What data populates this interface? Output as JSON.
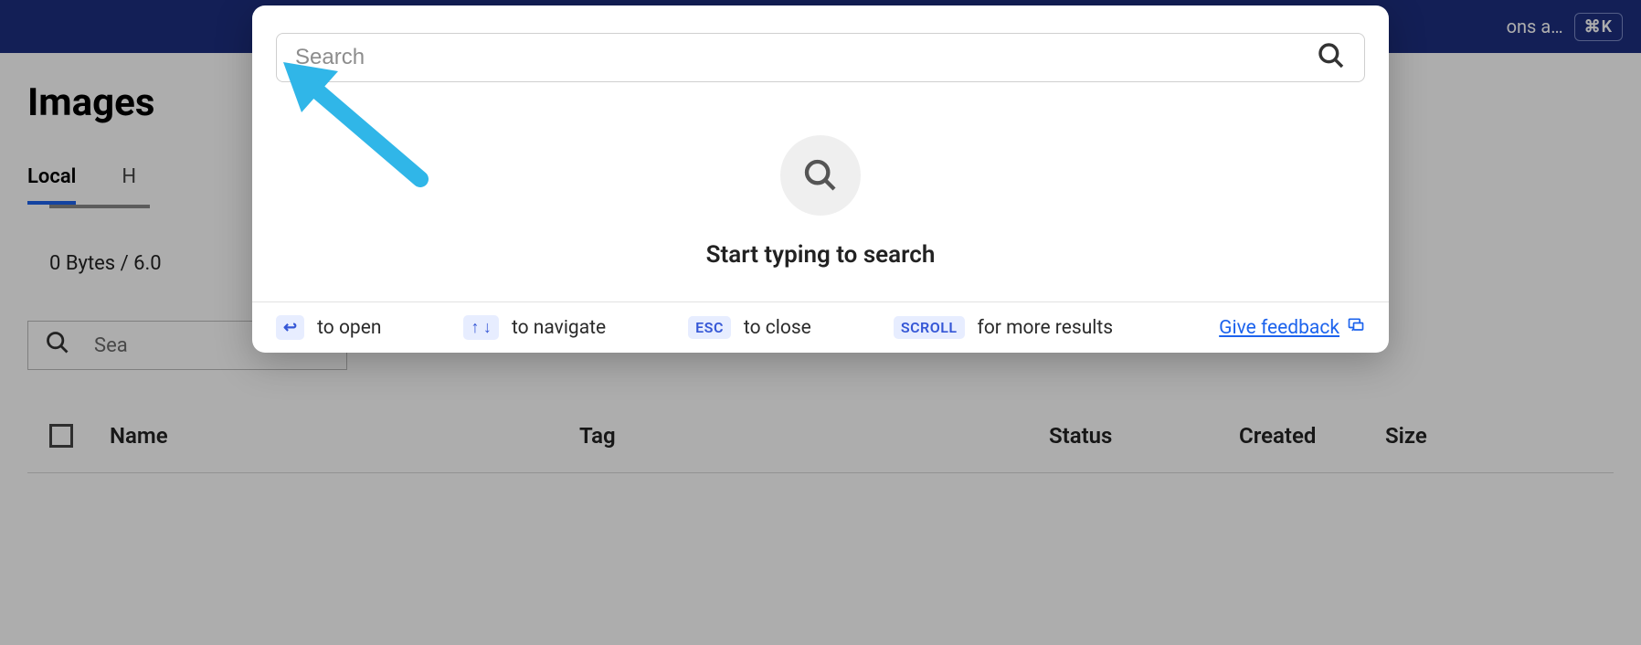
{
  "topbar": {
    "truncated_text": "ons a…",
    "shortcut": "⌘K"
  },
  "page": {
    "title": "Images",
    "tabs": {
      "local": "Local",
      "hub_partial": "H"
    },
    "storage": "0 Bytes / 6.0",
    "search_placeholder": "Sea"
  },
  "table": {
    "columns": {
      "name": "Name",
      "tag": "Tag",
      "status": "Status",
      "created": "Created",
      "size": "Size"
    }
  },
  "modal": {
    "search_placeholder": "Search",
    "empty_text": "Start typing to search",
    "hints": {
      "open_key": "↩",
      "open_label": "to open",
      "nav_key": "↑ ↓",
      "nav_label": "to navigate",
      "close_key": "ESC",
      "close_label": "to close",
      "scroll_key": "SCROLL",
      "scroll_label": "for more results"
    },
    "feedback": "Give feedback"
  }
}
